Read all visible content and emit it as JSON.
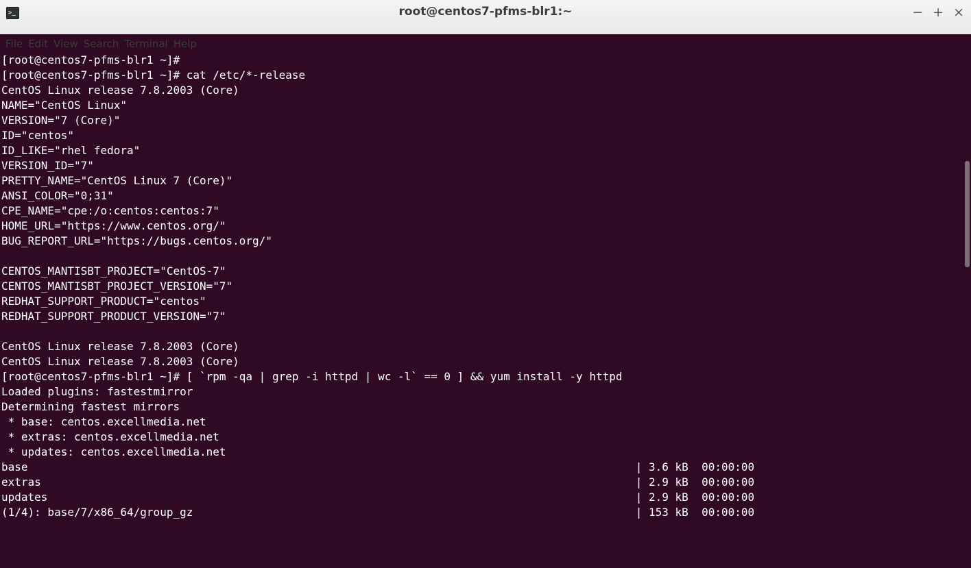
{
  "window": {
    "title": "root@centos7-pfms-blr1:~",
    "icon_glyph": ">_",
    "controls": {
      "minimize": "−",
      "maximize": "+",
      "close": "×"
    }
  },
  "menu": [
    "File",
    "Edit",
    "View",
    "Search",
    "Terminal",
    "Help"
  ],
  "terminal_lines": [
    "[root@centos7-pfms-blr1 ~]#",
    "[root@centos7-pfms-blr1 ~]# cat /etc/*-release",
    "CentOS Linux release 7.8.2003 (Core)",
    "NAME=\"CentOS Linux\"",
    "VERSION=\"7 (Core)\"",
    "ID=\"centos\"",
    "ID_LIKE=\"rhel fedora\"",
    "VERSION_ID=\"7\"",
    "PRETTY_NAME=\"CentOS Linux 7 (Core)\"",
    "ANSI_COLOR=\"0;31\"",
    "CPE_NAME=\"cpe:/o:centos:centos:7\"",
    "HOME_URL=\"https://www.centos.org/\"",
    "BUG_REPORT_URL=\"https://bugs.centos.org/\"",
    "",
    "CENTOS_MANTISBT_PROJECT=\"CentOS-7\"",
    "CENTOS_MANTISBT_PROJECT_VERSION=\"7\"",
    "REDHAT_SUPPORT_PRODUCT=\"centos\"",
    "REDHAT_SUPPORT_PRODUCT_VERSION=\"7\"",
    "",
    "CentOS Linux release 7.8.2003 (Core)",
    "CentOS Linux release 7.8.2003 (Core)",
    "[root@centos7-pfms-blr1 ~]# [ `rpm -qa | grep -i httpd | wc -l` == 0 ] && yum install -y httpd",
    "Loaded plugins: fastestmirror",
    "Determining fastest mirrors",
    " * base: centos.excellmedia.net",
    " * extras: centos.excellmedia.net",
    " * updates: centos.excellmedia.net",
    "base                                                                                            | 3.6 kB  00:00:00",
    "extras                                                                                          | 2.9 kB  00:00:00",
    "updates                                                                                         | 2.9 kB  00:00:00",
    "(1/4): base/7/x86_64/group_gz                                                                   | 153 kB  00:00:00"
  ],
  "colors": {
    "terminal_bg": "#300a24",
    "terminal_fg": "#ffffff",
    "titlebar_bg": "#efefee"
  }
}
